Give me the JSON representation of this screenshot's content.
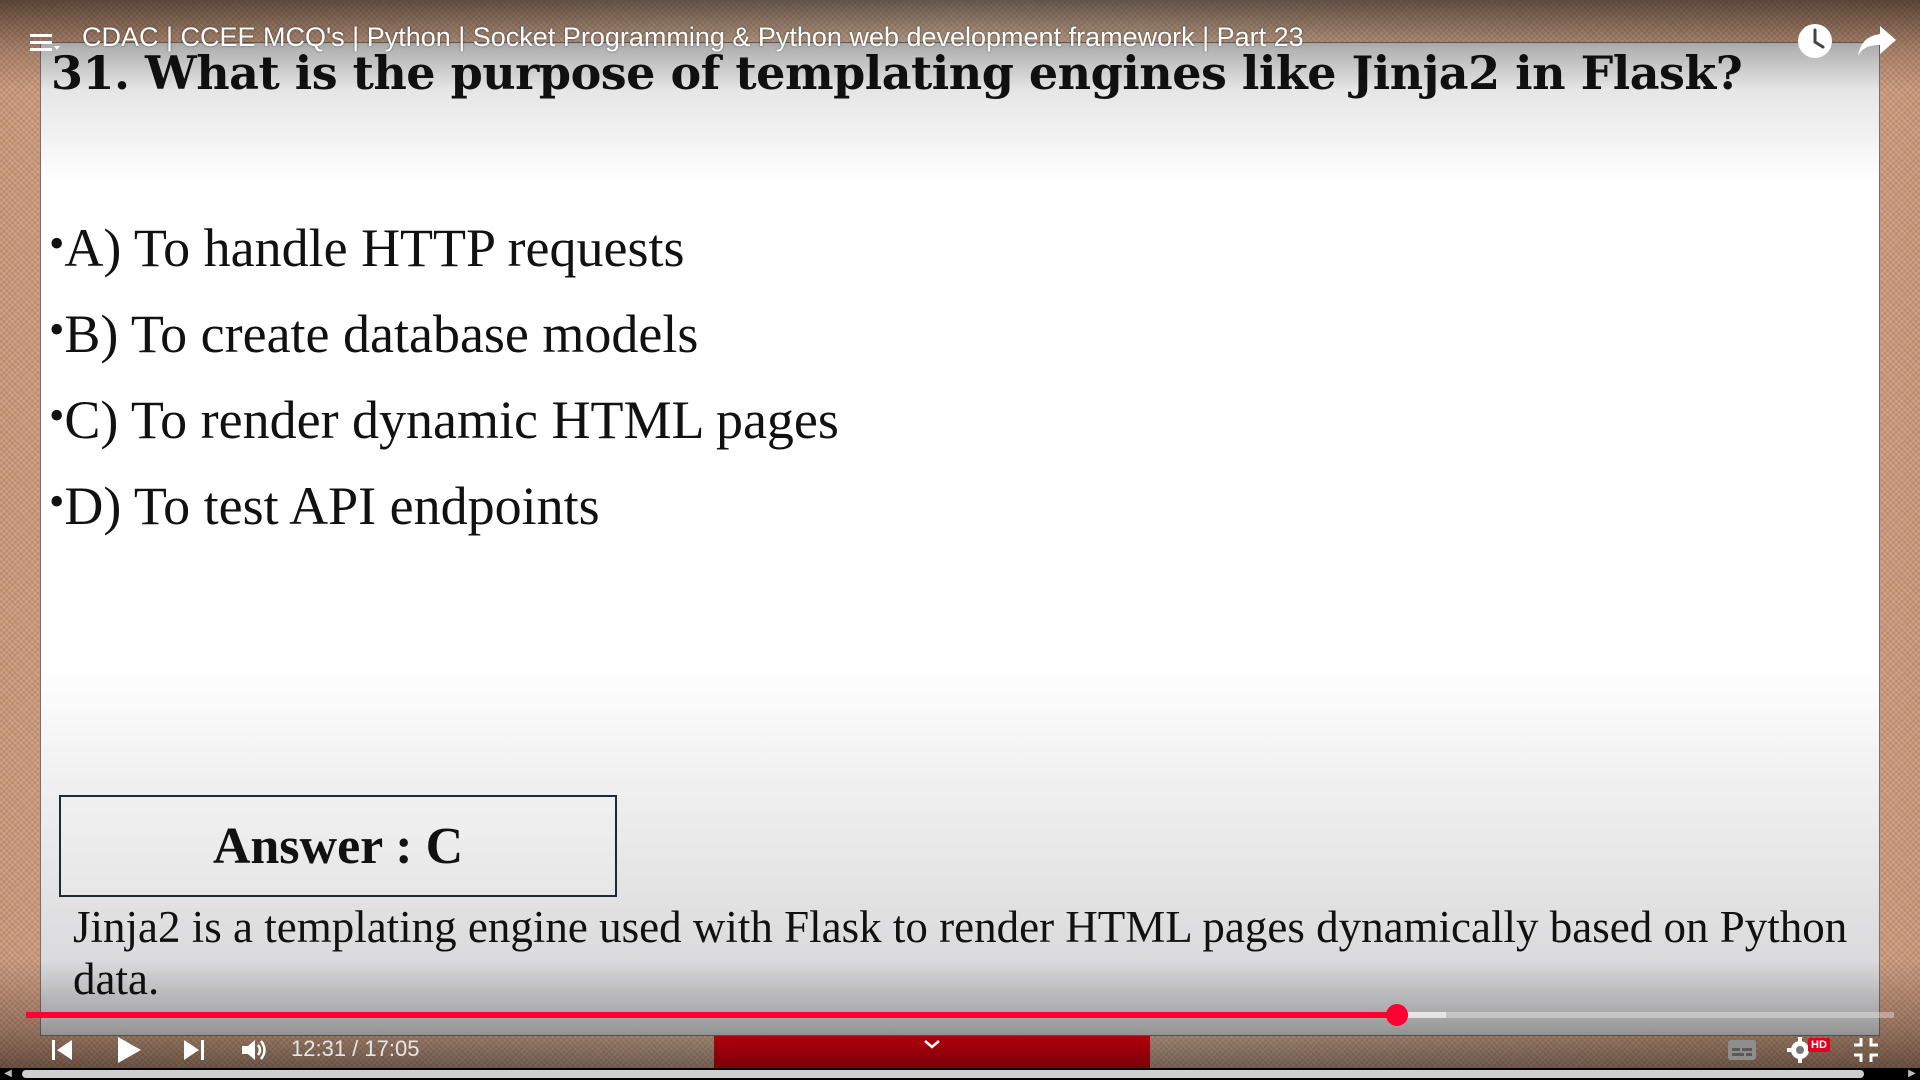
{
  "player": {
    "title": "CDAC | CCEE MCQ's | Python | Socket Programming & Python web development framework | Part 23",
    "current_time": "12:31",
    "total_time": "17:05",
    "time_separator": " / ",
    "progress_fraction": 0.734,
    "buffered_fraction": 0.76,
    "quality_badge": "HD",
    "accent_color": "#ff0033",
    "icons": {
      "menu": "menu-icon",
      "watch_later": "clock-icon",
      "share": "share-arrow-icon",
      "previous": "skip-previous-icon",
      "play": "play-icon",
      "next": "skip-next-icon",
      "volume": "volume-icon",
      "subtitles": "subtitles-icon",
      "settings": "gear-icon",
      "exit_fullscreen": "exit-fullscreen-icon",
      "chapter": "chevron-down-icon"
    }
  },
  "slide": {
    "question": "31. What is the purpose of  templating engines like Jinja2 in Flask?",
    "options": [
      "A) To handle HTTP requests",
      "B) To create database models",
      "C) To render dynamic HTML pages",
      "D) To test API endpoints"
    ],
    "bullet": "•",
    "answer": "Answer : C",
    "explanation": "Jinja2 is a templating engine used with Flask to render HTML pages dynamically based on Python data."
  }
}
